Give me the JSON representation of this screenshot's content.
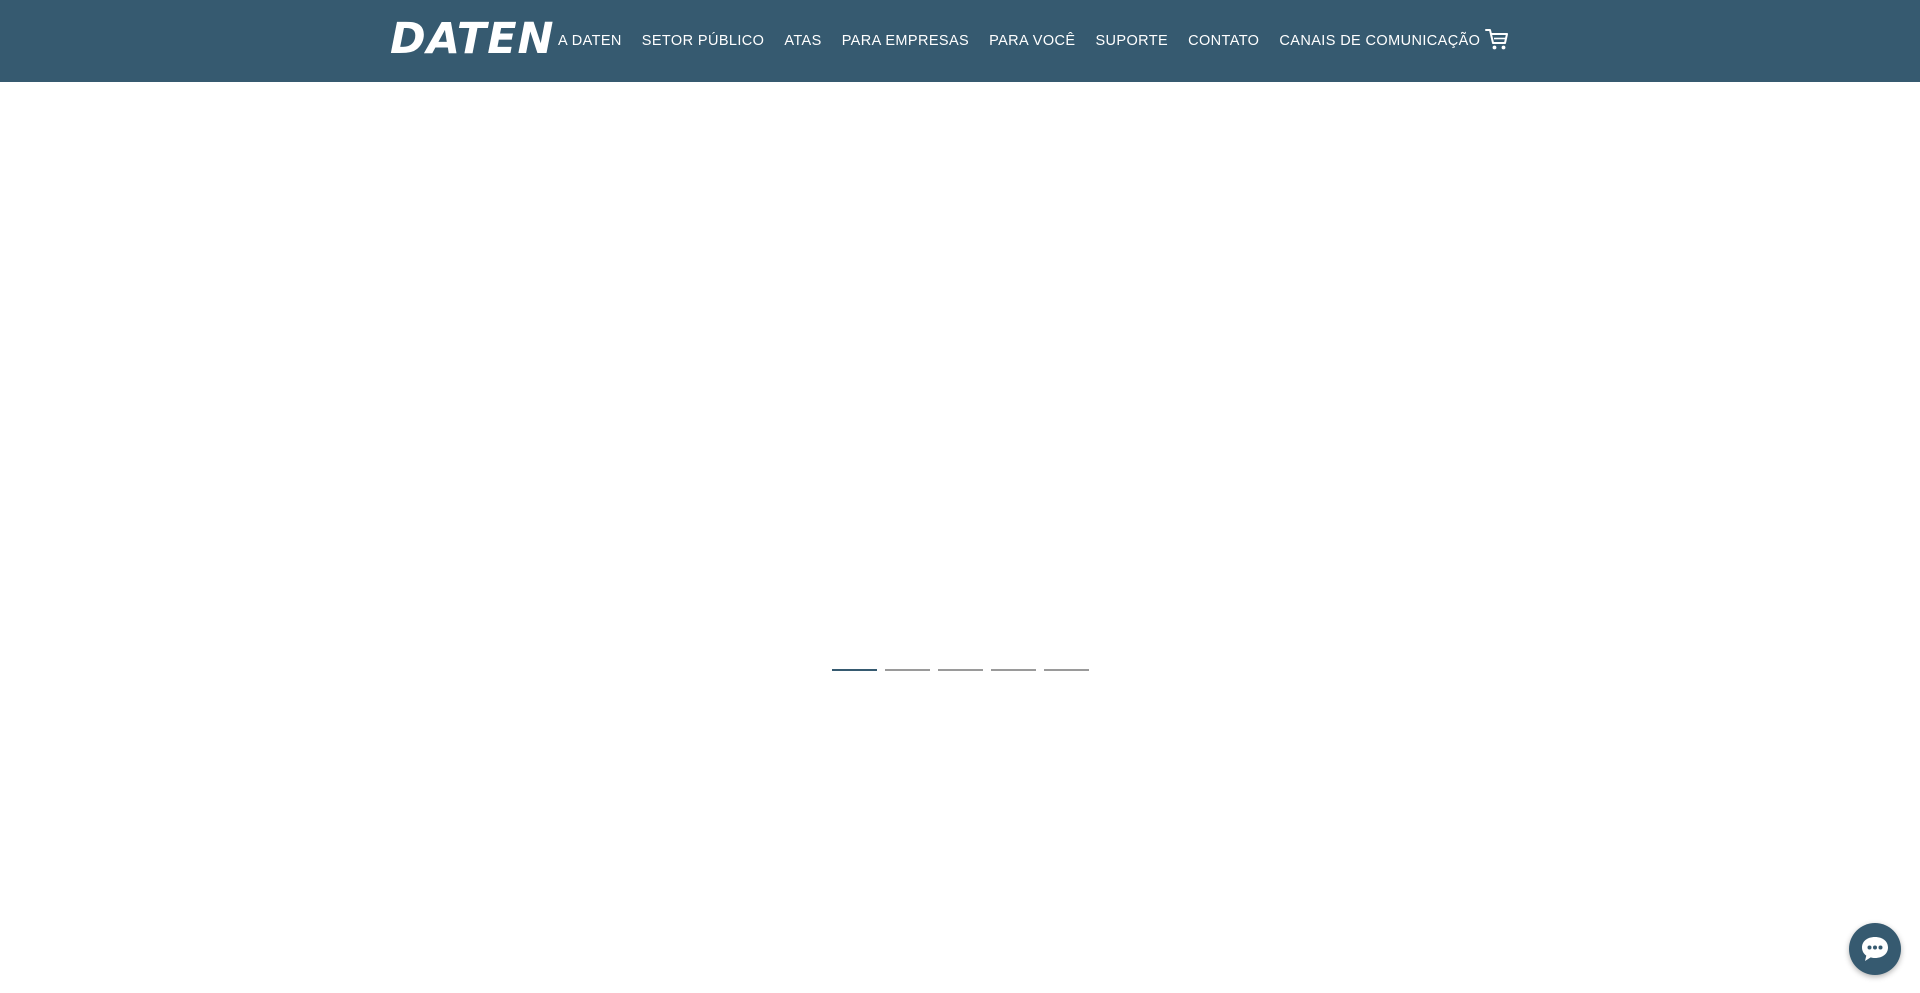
{
  "brand": {
    "logo_text": "DATEN",
    "primary_color": "#365a70"
  },
  "nav": {
    "items": [
      {
        "label": "A DATEN"
      },
      {
        "label": "SETOR PÚBLICO"
      },
      {
        "label": "ATAS"
      },
      {
        "label": "PARA EMPRESAS"
      },
      {
        "label": "PARA VOCÊ"
      },
      {
        "label": "SUPORTE"
      },
      {
        "label": "CONTATO"
      },
      {
        "label": "CANAIS DE COMUNICAÇÃO"
      }
    ],
    "cart_icon": "cart-icon"
  },
  "slider": {
    "slide_count": 5,
    "active_index": 0,
    "active_color": "#365a70",
    "inactive_color": "#9a9a9a"
  },
  "chat": {
    "icon": "chat-bubble-icon"
  }
}
